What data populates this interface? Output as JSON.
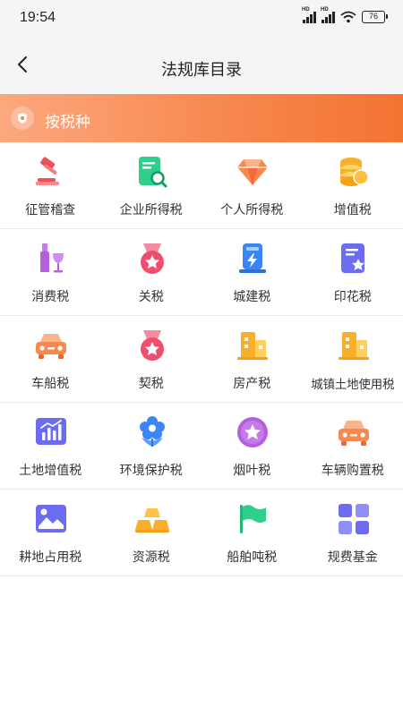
{
  "status_bar": {
    "time": "19:54",
    "battery": "76"
  },
  "nav": {
    "title": "法规库目录"
  },
  "section": {
    "label": "按税种"
  },
  "categories": [
    {
      "label": "征管稽查",
      "icon": "gavel-icon"
    },
    {
      "label": "企业所得税",
      "icon": "document-search-icon"
    },
    {
      "label": "个人所得税",
      "icon": "diamond-icon"
    },
    {
      "label": "增值税",
      "icon": "coin-stack-icon"
    },
    {
      "label": "消费税",
      "icon": "wine-icon"
    },
    {
      "label": "关税",
      "icon": "medal-icon"
    },
    {
      "label": "城建税",
      "icon": "charging-station-icon"
    },
    {
      "label": "印花税",
      "icon": "certificate-icon"
    },
    {
      "label": "车船税",
      "icon": "car-icon"
    },
    {
      "label": "契税",
      "icon": "medal-icon"
    },
    {
      "label": "房产税",
      "icon": "building-icon"
    },
    {
      "label": "城镇土地使用税",
      "icon": "building-icon"
    },
    {
      "label": "土地增值税",
      "icon": "bar-chart-icon"
    },
    {
      "label": "环境保护税",
      "icon": "flower-icon"
    },
    {
      "label": "烟叶税",
      "icon": "star-circle-icon"
    },
    {
      "label": "车辆购置税",
      "icon": "car-icon"
    },
    {
      "label": "耕地占用税",
      "icon": "landscape-icon"
    },
    {
      "label": "资源税",
      "icon": "gold-bars-icon"
    },
    {
      "label": "船舶吨税",
      "icon": "flag-icon"
    },
    {
      "label": "规费基金",
      "icon": "grid-icon"
    }
  ],
  "colors": {
    "accent_orange": "#f37332",
    "icon_red": "#f0505a",
    "icon_pink": "#ef4f6c",
    "icon_green": "#2ecf8a",
    "icon_purple": "#b35fe0",
    "icon_blue": "#3a86f5",
    "icon_indigo": "#6b6cf0",
    "icon_yellow": "#f8b02c"
  }
}
